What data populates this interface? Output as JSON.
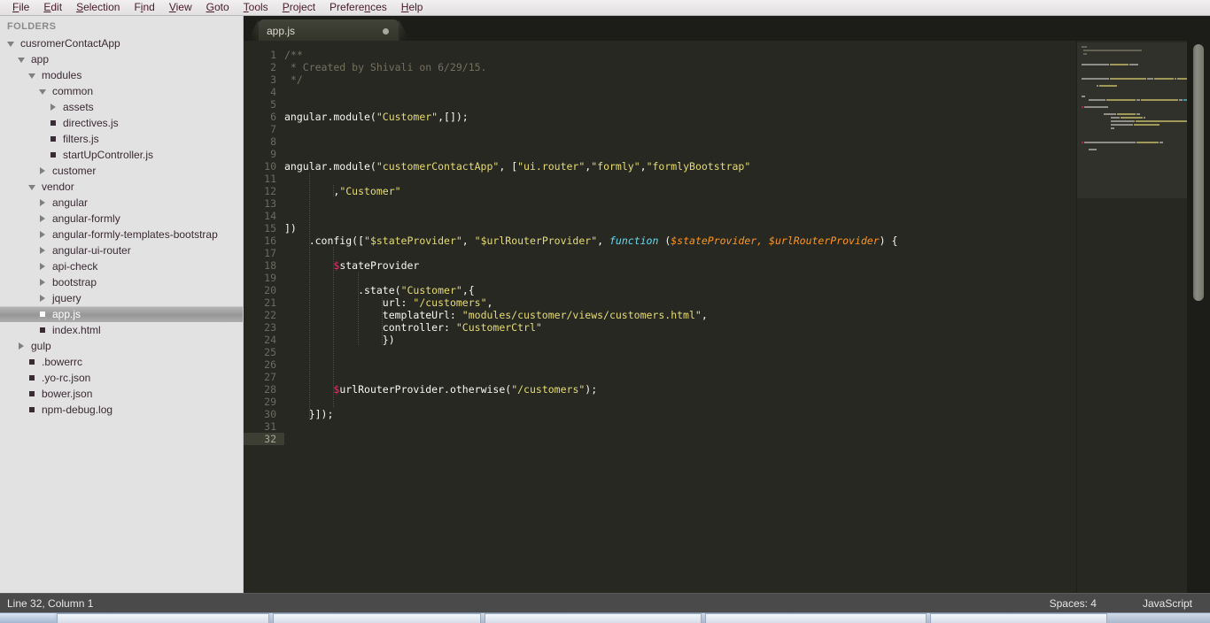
{
  "menu": {
    "items": [
      {
        "label": "File",
        "mnemonic_index": 0
      },
      {
        "label": "Edit",
        "mnemonic_index": 0
      },
      {
        "label": "Selection",
        "mnemonic_index": 0
      },
      {
        "label": "Find",
        "mnemonic_index": 1
      },
      {
        "label": "View",
        "mnemonic_index": 0
      },
      {
        "label": "Goto",
        "mnemonic_index": 0
      },
      {
        "label": "Tools",
        "mnemonic_index": 0
      },
      {
        "label": "Project",
        "mnemonic_index": 0
      },
      {
        "label": "Preferences",
        "mnemonic_index": 7
      },
      {
        "label": "Help",
        "mnemonic_index": 0
      }
    ]
  },
  "sidebar": {
    "header": "FOLDERS",
    "tree": [
      {
        "label": "cusromerContactApp",
        "depth": 0,
        "arrow": "down",
        "selected": false
      },
      {
        "label": "app",
        "depth": 1,
        "arrow": "down",
        "selected": false
      },
      {
        "label": "modules",
        "depth": 2,
        "arrow": "down",
        "selected": false
      },
      {
        "label": "common",
        "depth": 3,
        "arrow": "down",
        "selected": false
      },
      {
        "label": "assets",
        "depth": 4,
        "arrow": "right",
        "selected": false
      },
      {
        "label": "directives.js",
        "depth": 4,
        "arrow": "none",
        "selected": false
      },
      {
        "label": "filters.js",
        "depth": 4,
        "arrow": "none",
        "selected": false
      },
      {
        "label": "startUpController.js",
        "depth": 4,
        "arrow": "none",
        "selected": false
      },
      {
        "label": "customer",
        "depth": 3,
        "arrow": "right",
        "selected": false
      },
      {
        "label": "vendor",
        "depth": 2,
        "arrow": "down",
        "selected": false
      },
      {
        "label": "angular",
        "depth": 3,
        "arrow": "right",
        "selected": false
      },
      {
        "label": "angular-formly",
        "depth": 3,
        "arrow": "right",
        "selected": false
      },
      {
        "label": "angular-formly-templates-bootstrap",
        "depth": 3,
        "arrow": "right",
        "selected": false
      },
      {
        "label": "angular-ui-router",
        "depth": 3,
        "arrow": "right",
        "selected": false
      },
      {
        "label": "api-check",
        "depth": 3,
        "arrow": "right",
        "selected": false
      },
      {
        "label": "bootstrap",
        "depth": 3,
        "arrow": "right",
        "selected": false
      },
      {
        "label": "jquery",
        "depth": 3,
        "arrow": "right",
        "selected": false
      },
      {
        "label": "app.js",
        "depth": 3,
        "arrow": "none",
        "selected": true
      },
      {
        "label": "index.html",
        "depth": 3,
        "arrow": "none",
        "selected": false
      },
      {
        "label": "gulp",
        "depth": 1,
        "arrow": "right",
        "selected": false
      },
      {
        "label": ".bowerrc",
        "depth": 2,
        "arrow": "none",
        "selected": false
      },
      {
        "label": ".yo-rc.json",
        "depth": 2,
        "arrow": "none",
        "selected": false
      },
      {
        "label": "bower.json",
        "depth": 2,
        "arrow": "none",
        "selected": false
      },
      {
        "label": "npm-debug.log",
        "depth": 2,
        "arrow": "none",
        "selected": false
      }
    ]
  },
  "tabs": [
    {
      "title": "app.js",
      "dirty": true,
      "active": true
    }
  ],
  "editor": {
    "first_line": 1,
    "total_lines": 32,
    "cursor_line": 32,
    "lines": [
      {
        "n": 1,
        "tokens": [
          {
            "t": "cmt",
            "v": "/**"
          }
        ]
      },
      {
        "n": 2,
        "tokens": [
          {
            "t": "cmt",
            "v": " * Created by Shivali on 6/29/15."
          }
        ]
      },
      {
        "n": 3,
        "tokens": [
          {
            "t": "cmt",
            "v": " */"
          }
        ]
      },
      {
        "n": 4,
        "tokens": []
      },
      {
        "n": 5,
        "tokens": []
      },
      {
        "n": 6,
        "tokens": [
          {
            "t": "pl",
            "v": "angular.module("
          },
          {
            "t": "str",
            "v": "\"Customer\""
          },
          {
            "t": "pl",
            "v": ",[]);"
          }
        ]
      },
      {
        "n": 7,
        "tokens": []
      },
      {
        "n": 8,
        "tokens": []
      },
      {
        "n": 9,
        "tokens": []
      },
      {
        "n": 10,
        "tokens": [
          {
            "t": "pl",
            "v": "angular.module("
          },
          {
            "t": "str",
            "v": "\"customerContactApp\""
          },
          {
            "t": "pl",
            "v": ", ["
          },
          {
            "t": "str",
            "v": "\"ui.router\""
          },
          {
            "t": "pl",
            "v": ","
          },
          {
            "t": "str",
            "v": "\"formly\""
          },
          {
            "t": "pl",
            "v": ","
          },
          {
            "t": "str",
            "v": "\"formlyBootstrap\""
          }
        ]
      },
      {
        "n": 11,
        "tokens": []
      },
      {
        "n": 12,
        "tokens": [
          {
            "t": "pl",
            "v": "        ,"
          },
          {
            "t": "str",
            "v": "\"Customer\""
          }
        ]
      },
      {
        "n": 13,
        "tokens": []
      },
      {
        "n": 14,
        "tokens": []
      },
      {
        "n": 15,
        "tokens": [
          {
            "t": "pl",
            "v": "])"
          }
        ]
      },
      {
        "n": 16,
        "tokens": [
          {
            "t": "pl",
            "v": "    .config(["
          },
          {
            "t": "str",
            "v": "\"$stateProvider\""
          },
          {
            "t": "pl",
            "v": ", "
          },
          {
            "t": "str",
            "v": "\"$urlRouterProvider\""
          },
          {
            "t": "pl",
            "v": ", "
          },
          {
            "t": "kw",
            "v": "function"
          },
          {
            "t": "pl",
            "v": " ("
          },
          {
            "t": "par",
            "v": "$stateProvider, $urlRouterProvider"
          },
          {
            "t": "pl",
            "v": ") {"
          }
        ]
      },
      {
        "n": 17,
        "tokens": []
      },
      {
        "n": 18,
        "tokens": [
          {
            "t": "pl",
            "v": "        "
          },
          {
            "t": "dol",
            "v": "$"
          },
          {
            "t": "pl",
            "v": "stateProvider"
          }
        ]
      },
      {
        "n": 19,
        "tokens": []
      },
      {
        "n": 20,
        "tokens": [
          {
            "t": "pl",
            "v": "            .state("
          },
          {
            "t": "str",
            "v": "\"Customer\""
          },
          {
            "t": "pl",
            "v": ",{"
          }
        ]
      },
      {
        "n": 21,
        "tokens": [
          {
            "t": "pl",
            "v": "                url: "
          },
          {
            "t": "str",
            "v": "\"/customers\""
          },
          {
            "t": "pl",
            "v": ","
          }
        ]
      },
      {
        "n": 22,
        "tokens": [
          {
            "t": "pl",
            "v": "                templateUrl: "
          },
          {
            "t": "str",
            "v": "\"modules/customer/views/customers.html\""
          },
          {
            "t": "pl",
            "v": ","
          }
        ]
      },
      {
        "n": 23,
        "tokens": [
          {
            "t": "pl",
            "v": "                controller: "
          },
          {
            "t": "str",
            "v": "\"CustomerCtrl\""
          }
        ]
      },
      {
        "n": 24,
        "tokens": [
          {
            "t": "pl",
            "v": "                })"
          }
        ]
      },
      {
        "n": 25,
        "tokens": []
      },
      {
        "n": 26,
        "tokens": []
      },
      {
        "n": 27,
        "tokens": []
      },
      {
        "n": 28,
        "tokens": [
          {
            "t": "pl",
            "v": "        "
          },
          {
            "t": "dol",
            "v": "$"
          },
          {
            "t": "pl",
            "v": "urlRouterProvider.otherwise("
          },
          {
            "t": "str",
            "v": "\"/customers\""
          },
          {
            "t": "pl",
            "v": ");"
          }
        ]
      },
      {
        "n": 29,
        "tokens": []
      },
      {
        "n": 30,
        "tokens": [
          {
            "t": "pl",
            "v": "    }]);"
          }
        ]
      },
      {
        "n": 31,
        "tokens": []
      },
      {
        "n": 32,
        "tokens": []
      }
    ]
  },
  "statusbar": {
    "position": "Line 32, Column 1",
    "indentation": "Spaces: 4",
    "syntax": "JavaScript"
  },
  "colors": {
    "editor_background": "#272822",
    "sidebar_background": "#e2e2e2",
    "comment": "#75715e",
    "string": "#e6db74",
    "keyword": "#66d9ef",
    "parameter": "#fd971f",
    "variable_sigil": "#f92672",
    "plain_text": "#f8f8f2",
    "statusbar_background": "#4a4a4a"
  }
}
